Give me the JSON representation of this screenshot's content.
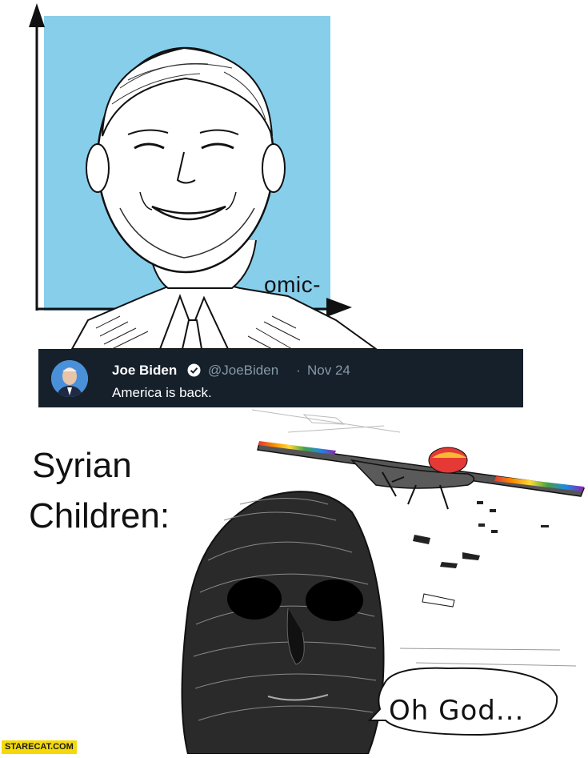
{
  "tweet": {
    "name": "Joe Biden",
    "handle": "@JoeBiden",
    "separator": "·",
    "date": "Nov 24",
    "text": "America is back."
  },
  "top_panel": {
    "axis_label": "omic-"
  },
  "bottom_panel": {
    "caption_line1": "Syrian",
    "caption_line2": "Children:",
    "speech_bubble": "Oh God..."
  },
  "watermark": "STARECAT.COM",
  "colors": {
    "sky_blue": "#87ceeb",
    "tweet_bg": "#15202b",
    "verified": "#1da1f2",
    "watermark_bg": "#f5d90a"
  }
}
